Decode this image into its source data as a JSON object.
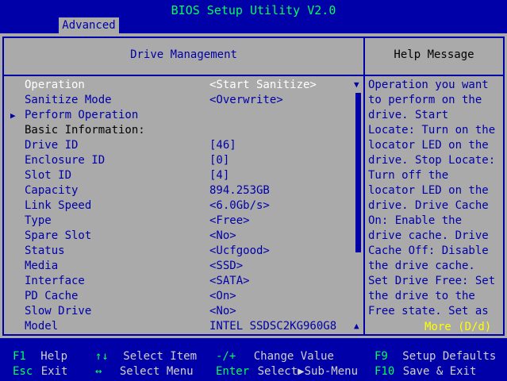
{
  "title": "BIOS Setup Utility V2.0",
  "tab": "Advanced",
  "left_header": "Drive Management",
  "right_header": "Help Message",
  "rows": [
    {
      "label": "Operation",
      "value": "<Start Sanitize>"
    },
    {
      "label": "Sanitize Mode",
      "value": "<Overwrite>"
    },
    {
      "label": "Perform Operation",
      "value": ""
    },
    {
      "label": "Basic Information:",
      "value": ""
    },
    {
      "label": "Drive ID",
      "value": "[46]"
    },
    {
      "label": "Enclosure ID",
      "value": "[0]"
    },
    {
      "label": "Slot ID",
      "value": "[4]"
    },
    {
      "label": "Capacity",
      "value": "894.253GB"
    },
    {
      "label": "Link Speed",
      "value": "<6.0Gb/s>"
    },
    {
      "label": "Type",
      "value": "<Free>"
    },
    {
      "label": "Spare Slot",
      "value": "<No>"
    },
    {
      "label": "Status",
      "value": "<Ucfgood>"
    },
    {
      "label": "Media",
      "value": "<SSD>"
    },
    {
      "label": "Interface",
      "value": "<SATA>"
    },
    {
      "label": "PD Cache",
      "value": "<On>"
    },
    {
      "label": "Slow Drive",
      "value": "<No>"
    },
    {
      "label": "Model",
      "value": "INTEL SSDSC2KG960G8"
    }
  ],
  "help_lines": [
    "Operation you want",
    "to perform on the",
    "drive. Start",
    "Locate: Turn on the",
    "locator LED on the",
    "drive. Stop Locate:",
    "Turn off the",
    "locator LED on the",
    "drive. Drive Cache",
    "On: Enable the",
    "drive cache. Drive",
    "Cache Off: Disable",
    "the drive cache.",
    "Set Drive Free: Set",
    "the drive to the",
    "Free state. Set as"
  ],
  "help_more": "More (D/d)",
  "footer": {
    "f1_key": "F1",
    "f1_desc": "Help",
    "esc_key": "Esc",
    "esc_desc": "Exit",
    "ud_key": "↑↓",
    "ud_desc": "Select Item",
    "lr_key": "↔",
    "lr_desc": "Select Menu",
    "pm_key": "-/+",
    "pm_desc": "Change Value",
    "enter_key": "Enter",
    "enter_desc": "Select▶Sub-Menu",
    "f9_key": "F9",
    "f9_desc": "Setup Defaults",
    "f10_key": "F10",
    "f10_desc": "Save & Exit"
  },
  "colors": {
    "background": "#0000a8",
    "panel": "#aaaaaa",
    "key": "#00ff5a",
    "highlight": "#ffffff",
    "more": "#ffff00"
  }
}
